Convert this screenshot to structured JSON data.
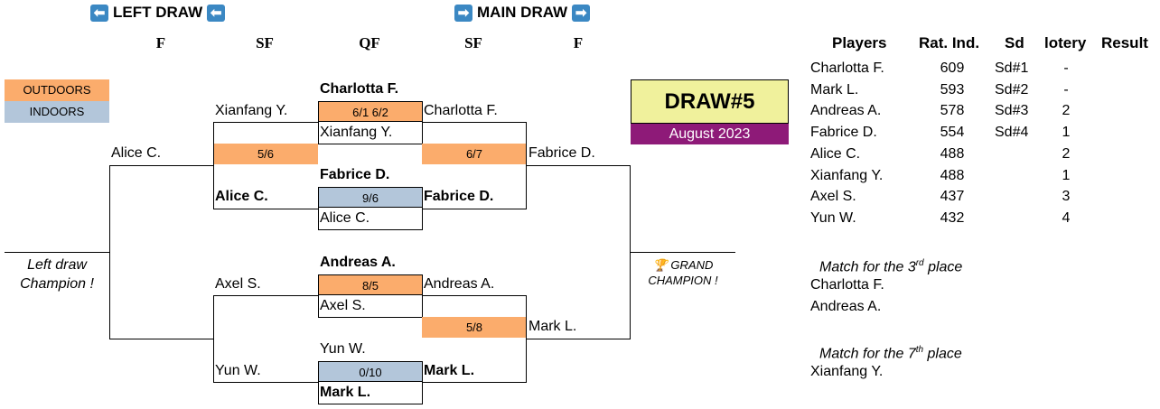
{
  "header": {
    "left_draw": "LEFT DRAW",
    "main_draw": "MAIN DRAW",
    "arrow_left": "⬅",
    "arrow_right": "➡"
  },
  "columns": {
    "f_left": "F",
    "sf_left": "SF",
    "qf": "QF",
    "sf_right": "SF",
    "f_right": "F"
  },
  "legend": {
    "outdoors": "OUTDOORS",
    "indoors": "INDOORS"
  },
  "draw": {
    "title": "DRAW#5",
    "date": "August 2023"
  },
  "bracket": {
    "qf1": {
      "top": "Charlotta F.",
      "score": "6/1 6/2",
      "bottom": "Xianfang Y."
    },
    "qf2": {
      "top": "Fabrice D.",
      "score": "9/6",
      "bottom": "Alice C."
    },
    "qf3": {
      "top": "Andreas A.",
      "score": "8/5",
      "bottom": "Axel S."
    },
    "qf4": {
      "top": "Yun W.",
      "score": "0/10",
      "bottom": "Mark L."
    },
    "left_sf1": {
      "top": "Xianfang Y.",
      "score": "5/6",
      "bottom": "Alice C."
    },
    "left_sf2": {
      "top": "Axel S.",
      "bottom": "Yun W."
    },
    "left_f": {
      "top": "Alice C."
    },
    "right_sf1": {
      "top": "Charlotta F.",
      "score": "6/7",
      "bottom": "Fabrice D."
    },
    "right_sf2": {
      "top": "Andreas A.",
      "score": "5/8",
      "bottom": "Mark L."
    },
    "right_f": {
      "top": "Fabrice D.",
      "bottom": "Mark L."
    },
    "left_champion": "Left draw\nChampion !",
    "grand_champion": "GRAND\nCHAMPION !",
    "trophy": "🏆"
  },
  "players_table": {
    "headers": [
      "Players",
      "Rat. Ind.",
      "Sd",
      "lotery",
      "Result"
    ],
    "rows": [
      {
        "player": "Charlotta F.",
        "rating": "609",
        "seed": "Sd#1",
        "lotery": "-",
        "result": ""
      },
      {
        "player": "Mark L.",
        "rating": "593",
        "seed": "Sd#2",
        "lotery": "-",
        "result": ""
      },
      {
        "player": "Andreas A.",
        "rating": "578",
        "seed": "Sd#3",
        "lotery": "2",
        "result": ""
      },
      {
        "player": "Fabrice D.",
        "rating": "554",
        "seed": "Sd#4",
        "lotery": "1",
        "result": ""
      },
      {
        "player": "Alice C.",
        "rating": "488",
        "seed": "",
        "lotery": "2",
        "result": ""
      },
      {
        "player": "Xianfang Y.",
        "rating": "488",
        "seed": "",
        "lotery": "1",
        "result": ""
      },
      {
        "player": "Axel S.",
        "rating": "437",
        "seed": "",
        "lotery": "3",
        "result": ""
      },
      {
        "player": "Yun W.",
        "rating": "432",
        "seed": "",
        "lotery": "4",
        "result": ""
      }
    ]
  },
  "placement": {
    "third": {
      "prefix": "Match for the 3",
      "sup": "rd",
      "suffix": " place",
      "players": [
        "Charlotta F.",
        "Andreas A."
      ]
    },
    "seventh": {
      "prefix": "Match for the 7",
      "sup": "th",
      "suffix": " place",
      "players": [
        "Xianfang Y."
      ]
    }
  }
}
